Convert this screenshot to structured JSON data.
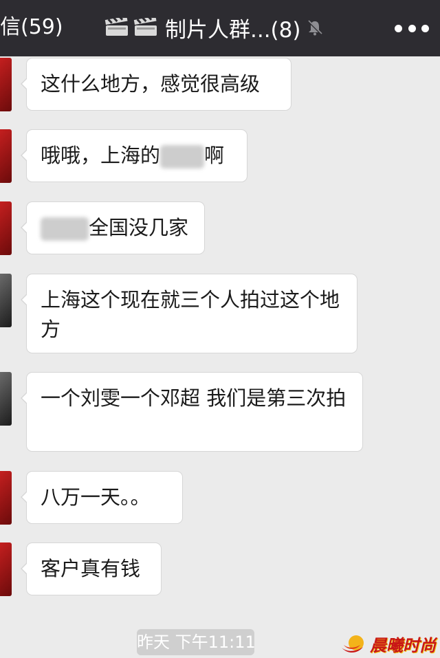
{
  "header": {
    "back_label": "信(59)",
    "title": "🎬🎬制片人群...(8)",
    "title_text": "制片人群...(8)",
    "icons": [
      "clapperboard-icon",
      "clapperboard-icon",
      "mute-icon",
      "more-icon"
    ],
    "background": "#2d2c31"
  },
  "messages": [
    {
      "text": "这什么地方，感觉很高级"
    },
    {
      "prefix": "哦哦，上海的",
      "suffix": "啊",
      "redacted": true
    },
    {
      "prefix": "",
      "suffix": "全国没几家",
      "redacted": true
    },
    {
      "text": "上海这个现在就三个人拍过这个地方"
    },
    {
      "text": "一个刘雯一个邓超 我们是第三次拍"
    },
    {
      "text": "八万一天。。"
    },
    {
      "text": "客户真有钱"
    }
  ],
  "timestamp": "昨天 下午11:11",
  "watermark": {
    "text": "晨曦时尚",
    "color": "#c81616"
  },
  "colors": {
    "chat_background": "#ebebeb",
    "bubble": "#ffffff",
    "avatar_red": "#c41f1f"
  }
}
